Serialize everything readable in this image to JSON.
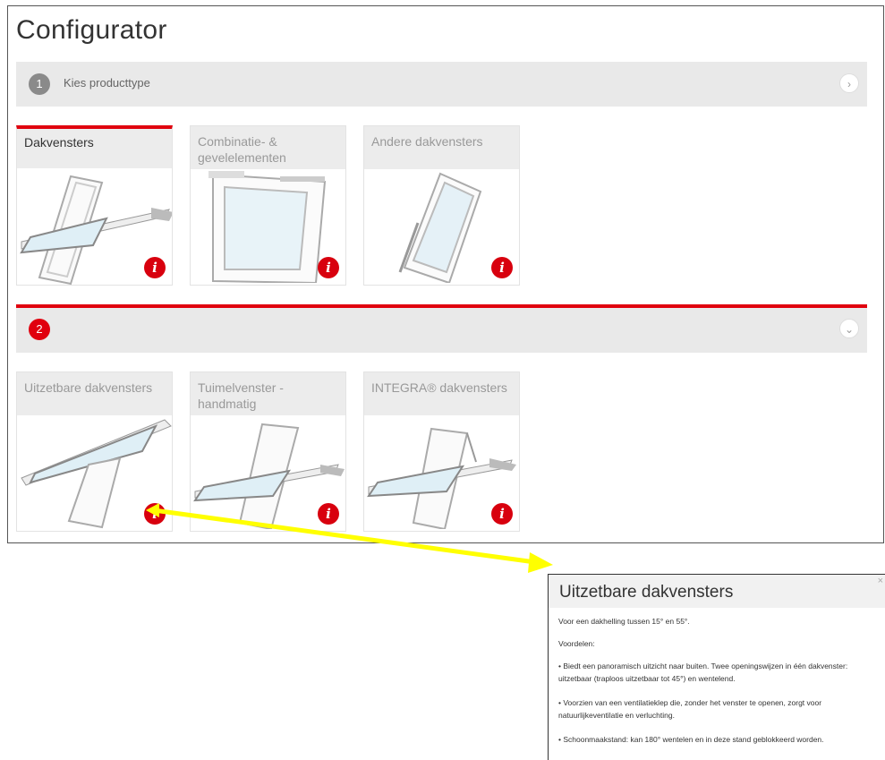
{
  "title": "Configurator",
  "step1": {
    "number": "1",
    "label": "Kies producttype"
  },
  "step2": {
    "number": "2"
  },
  "product_types": [
    {
      "label": "Dakvensters",
      "selected": true
    },
    {
      "label": "Combinatie- & gevelelementen",
      "selected": false
    },
    {
      "label": "Andere dakvensters",
      "selected": false
    }
  ],
  "window_types": [
    {
      "label": "Uitzetbare dakvensters"
    },
    {
      "label": "Tuimelvenster - handmatig"
    },
    {
      "label": "INTEGRA® dakvensters"
    }
  ],
  "info_glyph": "i",
  "chevron_right": "›",
  "chevron_down": "⌄",
  "popup": {
    "title": "Uitzetbare dakvensters",
    "close": "×",
    "paragraphs": [
      "Voor een dakhelling tussen 15° en 55°.",
      "Voordelen:",
      "• Biedt een panoramisch uitzicht naar buiten. Twee openingswijzen in één dakvenster: uitzetbaar (traploos uitzetbaar tot 45°) en wentelend.",
      "• Voorzien van een ventilatieklep die, zonder het venster te openen, zorgt voor natuurlijkeventilatie en verluchting.",
      "• Schoonmaakstand: kan 180° wentelen en in deze stand geblokkeerd worden."
    ]
  },
  "colors": {
    "accent": "#e0000e",
    "arrow": "#ffff00",
    "panel": "#e9e9e9"
  }
}
